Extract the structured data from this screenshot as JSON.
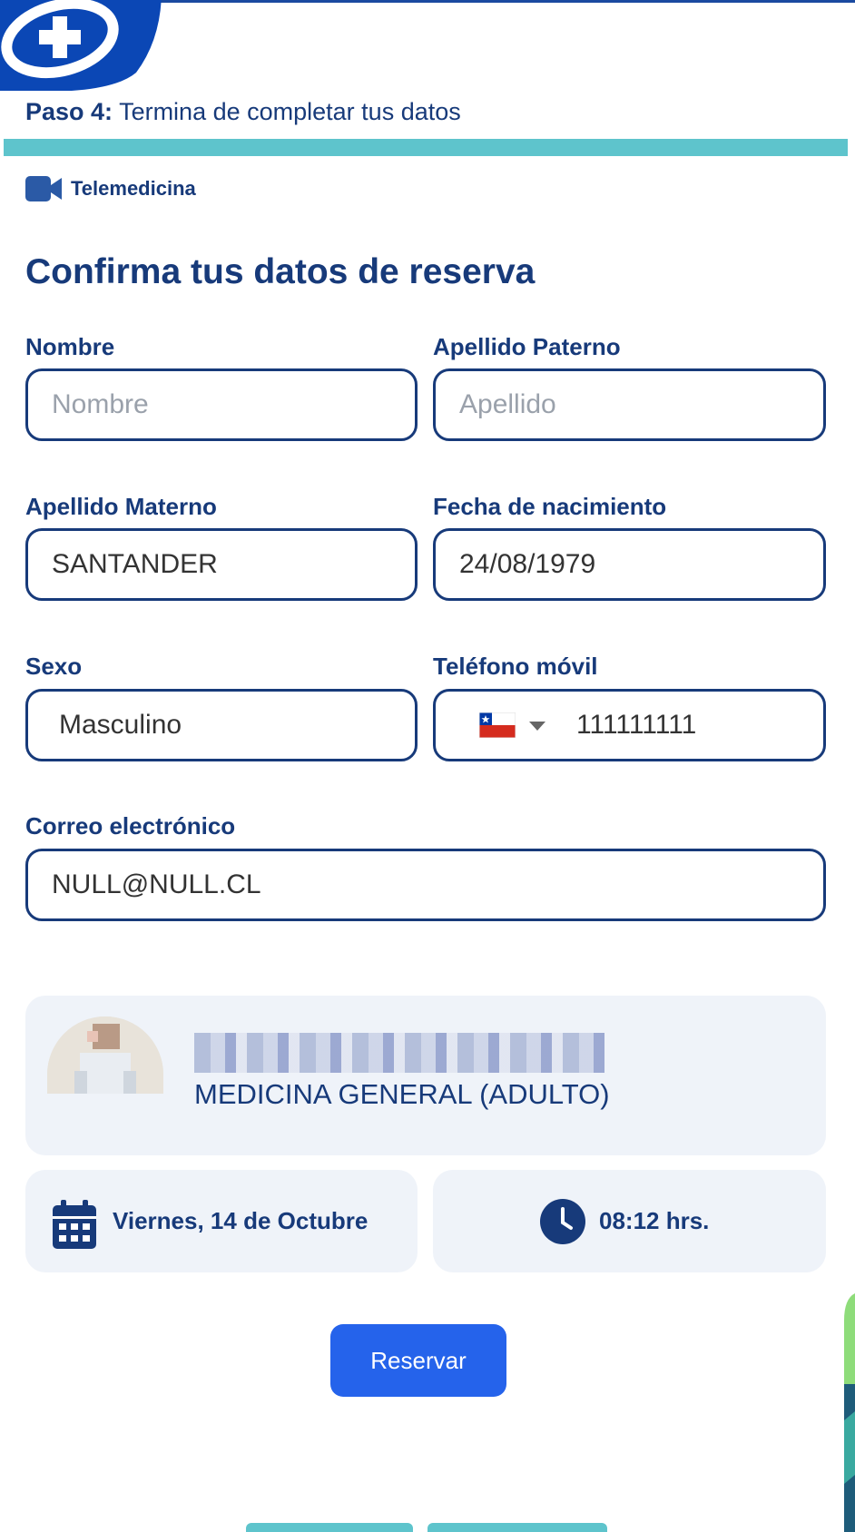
{
  "header": {
    "step_label": "Paso 4:",
    "step_text": "Termina de completar tus datos",
    "progress_percent": 100,
    "progress_color": "#5ec4cc",
    "brand_color": "#0b47b5"
  },
  "appointment_type": {
    "icon": "video-camera-icon",
    "label": "Telemedicina"
  },
  "form": {
    "title": "Confirma tus datos de reserva",
    "nombre": {
      "label": "Nombre",
      "placeholder": "Nombre",
      "value": ""
    },
    "apellido_paterno": {
      "label": "Apellido Paterno",
      "placeholder": "Apellido",
      "value": ""
    },
    "apellido_materno": {
      "label": "Apellido Materno",
      "value": "SANTANDER"
    },
    "fecha_nacimiento": {
      "label": "Fecha de nacimiento",
      "value": "24/08/1979"
    },
    "sexo": {
      "label": "Sexo",
      "value": "Masculino"
    },
    "telefono": {
      "label": "Teléfono móvil",
      "country_icon": "chile-flag-icon",
      "value": "111111111"
    },
    "correo": {
      "label": "Correo electrónico",
      "value": "NULL@NULL.CL"
    }
  },
  "doctor": {
    "avatar_icon": "doctor-photo",
    "specialty": "MEDICINA GENERAL (ADULTO)"
  },
  "schedule": {
    "date_icon": "calendar-icon",
    "date": "Viernes, 14 de Octubre",
    "time_icon": "clock-icon",
    "time": "08:12 hrs."
  },
  "actions": {
    "reserve_label": "Reservar",
    "reserve_color": "#2563eb"
  }
}
